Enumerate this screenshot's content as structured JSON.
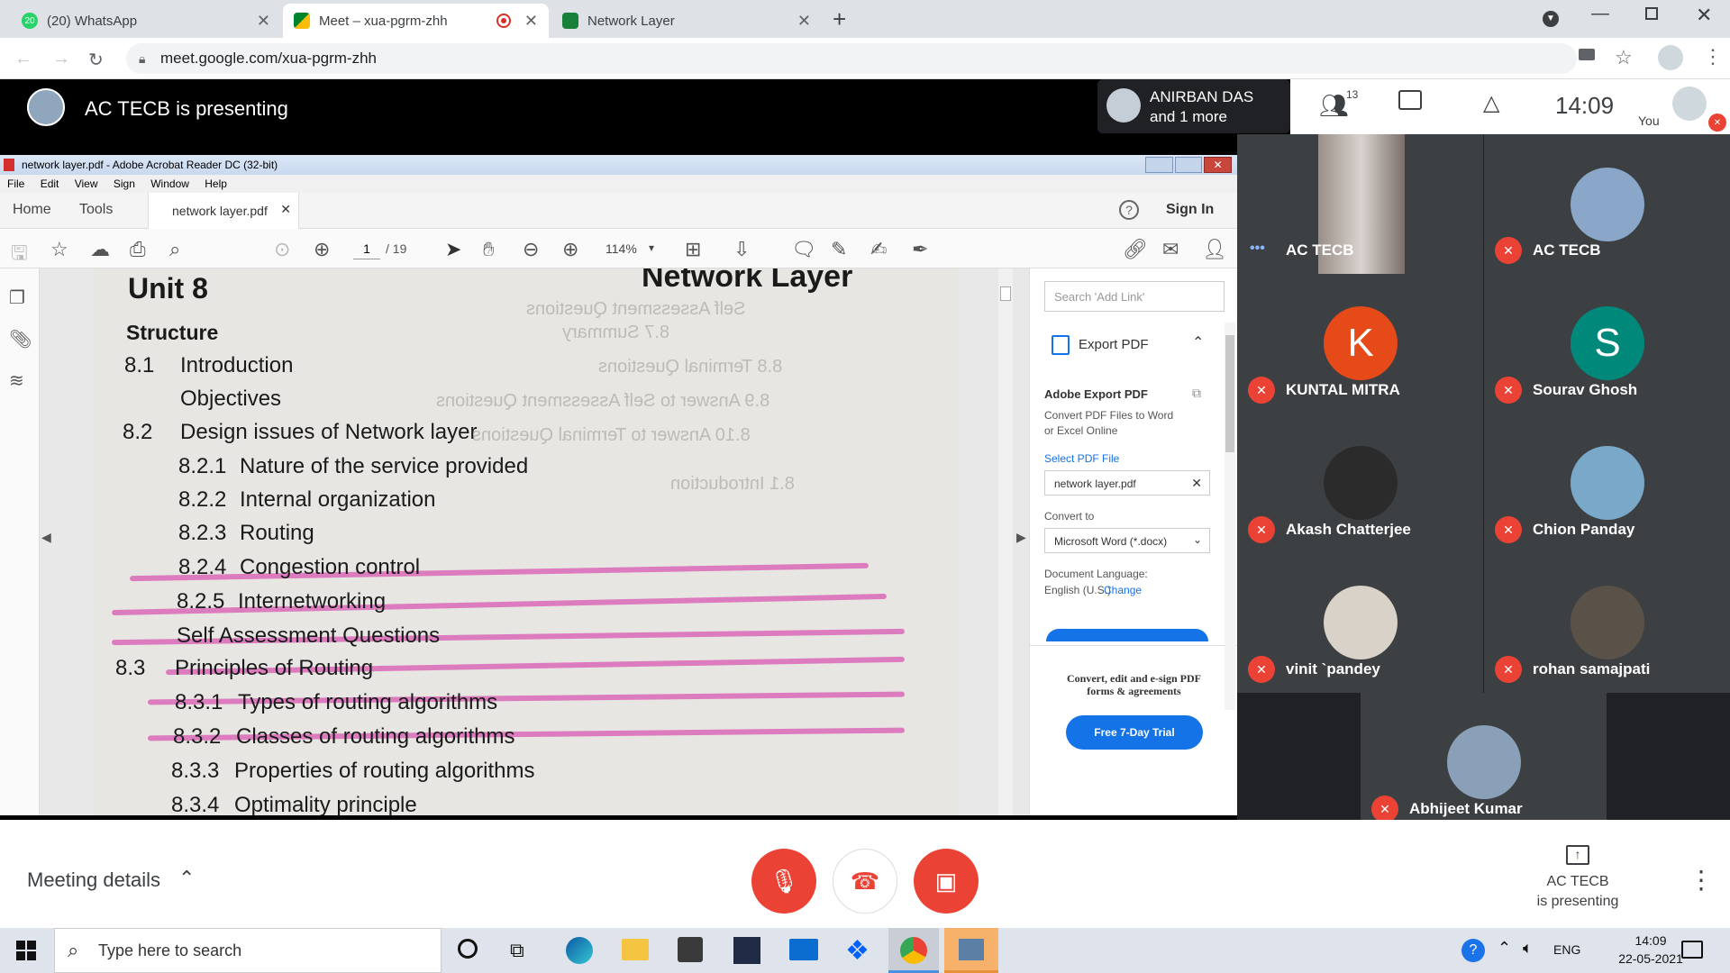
{
  "browser": {
    "tabs": [
      {
        "title": "(20) WhatsApp",
        "badge": "20"
      },
      {
        "title": "Meet – xua-pgrm-zhh"
      },
      {
        "title": "Network Layer"
      }
    ],
    "url": "meet.google.com/xua-pgrm-zhh"
  },
  "meet": {
    "presenting_banner": "AC TECB is presenting",
    "presenter_label_1": "ANIRBAN DAS",
    "presenter_label_2": "and 1 more",
    "people_count": "13",
    "time": "14:09",
    "you_label": "You",
    "meeting_details": "Meeting details",
    "presenting_status_1": "AC TECB",
    "presenting_status_2": "is presenting"
  },
  "acrobat": {
    "title": "network layer.pdf - Adobe Acrobat Reader DC (32-bit)",
    "menu": [
      "File",
      "Edit",
      "View",
      "Sign",
      "Window",
      "Help"
    ],
    "home_tab": "Home",
    "tools_tab": "Tools",
    "doc_tab": "network layer.pdf",
    "sign_in": "Sign In",
    "page_current": "1",
    "page_total": "/ 19",
    "zoom": "114%",
    "search_placeholder": "Search 'Add Link'",
    "export_pdf": "Export PDF",
    "adobe_export_title": "Adobe Export PDF",
    "adobe_export_desc_1": "Convert PDF Files to Word",
    "adobe_export_desc_2": "or Excel Online",
    "select_pdf_file": "Select PDF File",
    "selected_file": "network layer.pdf",
    "convert_to": "Convert to",
    "convert_option": "Microsoft Word (*.docx)",
    "doc_language_label": "Document Language:",
    "doc_language": "English (U.S.)",
    "change": "Change",
    "promo_1": "Convert, edit and e-sign PDF",
    "promo_2": "forms & agreements",
    "trial_button": "Free 7-Day Trial"
  },
  "document": {
    "unit": "Unit 8",
    "header_right": "Network Layer",
    "structure": "Structure",
    "lines": [
      {
        "num": "8.1",
        "text": "Introduction"
      },
      {
        "num": "",
        "text": "Objectives"
      },
      {
        "num": "8.2",
        "text": "Design issues of Network layer"
      },
      {
        "num": "8.2.1",
        "text": "Nature of the service provided"
      },
      {
        "num": "8.2.2",
        "text": "Internal organization"
      },
      {
        "num": "8.2.3",
        "text": "Routing"
      },
      {
        "num": "8.2.4",
        "text": "Congestion control"
      },
      {
        "num": "8.2.5",
        "text": "Internetworking"
      },
      {
        "num": "",
        "text": "Self Assessment Questions"
      },
      {
        "num": "8.3",
        "text": "Principles of Routing"
      },
      {
        "num": "8.3.1",
        "text": "Types of routing algorithms"
      },
      {
        "num": "8.3.2",
        "text": "Classes of routing  algorithms"
      },
      {
        "num": "8.3.3",
        "text": "Properties of routing algorithms"
      },
      {
        "num": "8.3.4",
        "text": "Optimality principle"
      }
    ],
    "ghost_lines": [
      "Self Assessment Questions",
      "8.7 Summary",
      "8.8 Terminal Questions",
      "8.9 Answer to Self Assessment Questions",
      "8.10 Answer to Terminal Questions",
      "8.1 Introduction"
    ]
  },
  "participants": [
    {
      "name": "AC TECB",
      "avatar_color": "#5f6368",
      "letter": ""
    },
    {
      "name": "AC TECB",
      "avatar_color": "#8aa6c8",
      "letter": ""
    },
    {
      "name": "KUNTAL MITRA",
      "avatar_color": "#e64a19",
      "letter": "K"
    },
    {
      "name": "Sourav Ghosh",
      "avatar_color": "#00897b",
      "letter": "S"
    },
    {
      "name": "Akash Chatterjee",
      "avatar_color": "#2b2b2b",
      "letter": ""
    },
    {
      "name": "Chion Panday",
      "avatar_color": "#7aa8c9",
      "letter": ""
    },
    {
      "name": "vinit `pandey",
      "avatar_color": "#d8d2c8",
      "letter": ""
    },
    {
      "name": "rohan samajpati",
      "avatar_color": "#5a5248",
      "letter": ""
    },
    {
      "name": "Abhijeet Kumar",
      "avatar_color": "#8aa0b8",
      "letter": ""
    }
  ],
  "taskbar": {
    "search_placeholder": "Type here to search",
    "lang": "ENG",
    "time": "14:09",
    "date": "22-05-2021"
  },
  "colors": {
    "meet_red": "#ea4335",
    "meet_dark": "#202124",
    "tile_gray": "#3c4043",
    "adobe_blue": "#1473e6"
  }
}
